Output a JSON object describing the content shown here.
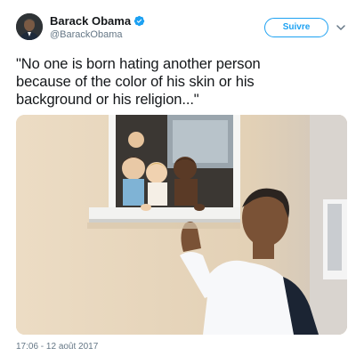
{
  "tweet": {
    "author": {
      "display_name": "Barack Obama",
      "handle": "@BarackObama",
      "verified": true,
      "avatar_icon": "profile-photo"
    },
    "follow_label": "Suivre",
    "menu_icon": "chevron-down-icon",
    "text": "\"No one is born hating another person\nbecause of the color of his skin or his\nbackground or his religion...\"",
    "timestamp": "17:06 - 12 août 2017",
    "colors": {
      "accent": "#1da1f2",
      "text": "#14171a",
      "secondary_text": "#657786"
    }
  }
}
